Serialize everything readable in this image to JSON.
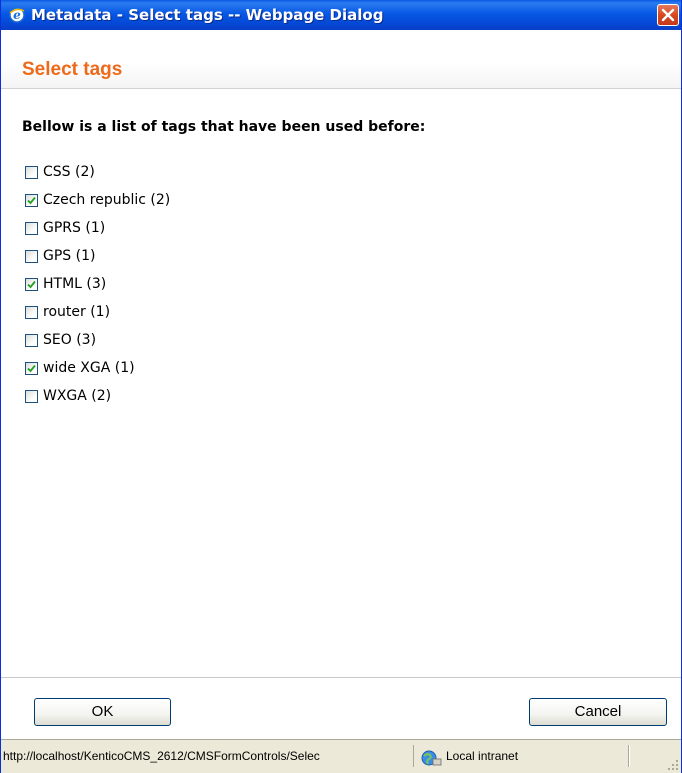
{
  "window": {
    "title": "Metadata - Select tags -- Webpage Dialog",
    "icon": "ie-icon",
    "close_icon": "close-icon"
  },
  "header": {
    "title": "Select tags",
    "title_color": "#ee6a1a"
  },
  "content": {
    "intro": "Bellow is a list of tags that have been used before:",
    "tags": [
      {
        "label": "CSS (2)",
        "checked": false
      },
      {
        "label": "Czech republic (2)",
        "checked": true
      },
      {
        "label": "GPRS (1)",
        "checked": false
      },
      {
        "label": "GPS (1)",
        "checked": false
      },
      {
        "label": "HTML (3)",
        "checked": true
      },
      {
        "label": "router (1)",
        "checked": false
      },
      {
        "label": "SEO (3)",
        "checked": false
      },
      {
        "label": "wide XGA (1)",
        "checked": true
      },
      {
        "label": "WXGA (2)",
        "checked": false
      }
    ]
  },
  "footer": {
    "ok_label": "OK",
    "cancel_label": "Cancel"
  },
  "statusbar": {
    "url": "http://localhost/KenticoCMS_2612/CMSFormControls/Selec",
    "zone": "Local intranet",
    "zone_icon": "local-intranet-icon"
  },
  "colors": {
    "titlebar": "#0758e5",
    "check": "#21a121",
    "checkbox_border": "#1c5180"
  }
}
